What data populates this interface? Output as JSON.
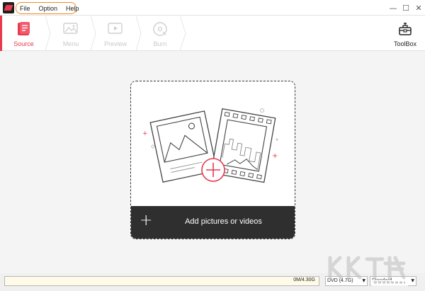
{
  "menu": {
    "file": "File",
    "option": "Option",
    "help": "Help"
  },
  "window": {
    "minimize": "—",
    "maximize": "☐",
    "close": "✕"
  },
  "steps": [
    {
      "label": "Source",
      "active": true,
      "icon": "document-icon"
    },
    {
      "label": "Menu",
      "active": false,
      "icon": "picture-icon"
    },
    {
      "label": "Preview",
      "active": false,
      "icon": "play-icon"
    },
    {
      "label": "Burn",
      "active": false,
      "icon": "disc-icon"
    }
  ],
  "toolbox": {
    "label": "ToolBox",
    "icon": "toolbox-icon"
  },
  "dropzone": {
    "add_label": "Add pictures or videos",
    "plus": "+"
  },
  "status": {
    "capacity_text": "0M/4.30G",
    "capacity_used_fraction": 0,
    "disc_type": "DVD (4.7G)",
    "quality": "Standard"
  },
  "colors": {
    "accent": "#e8394d",
    "highlight_border": "#f08c1c",
    "dark_bar": "#2f2f2f"
  }
}
